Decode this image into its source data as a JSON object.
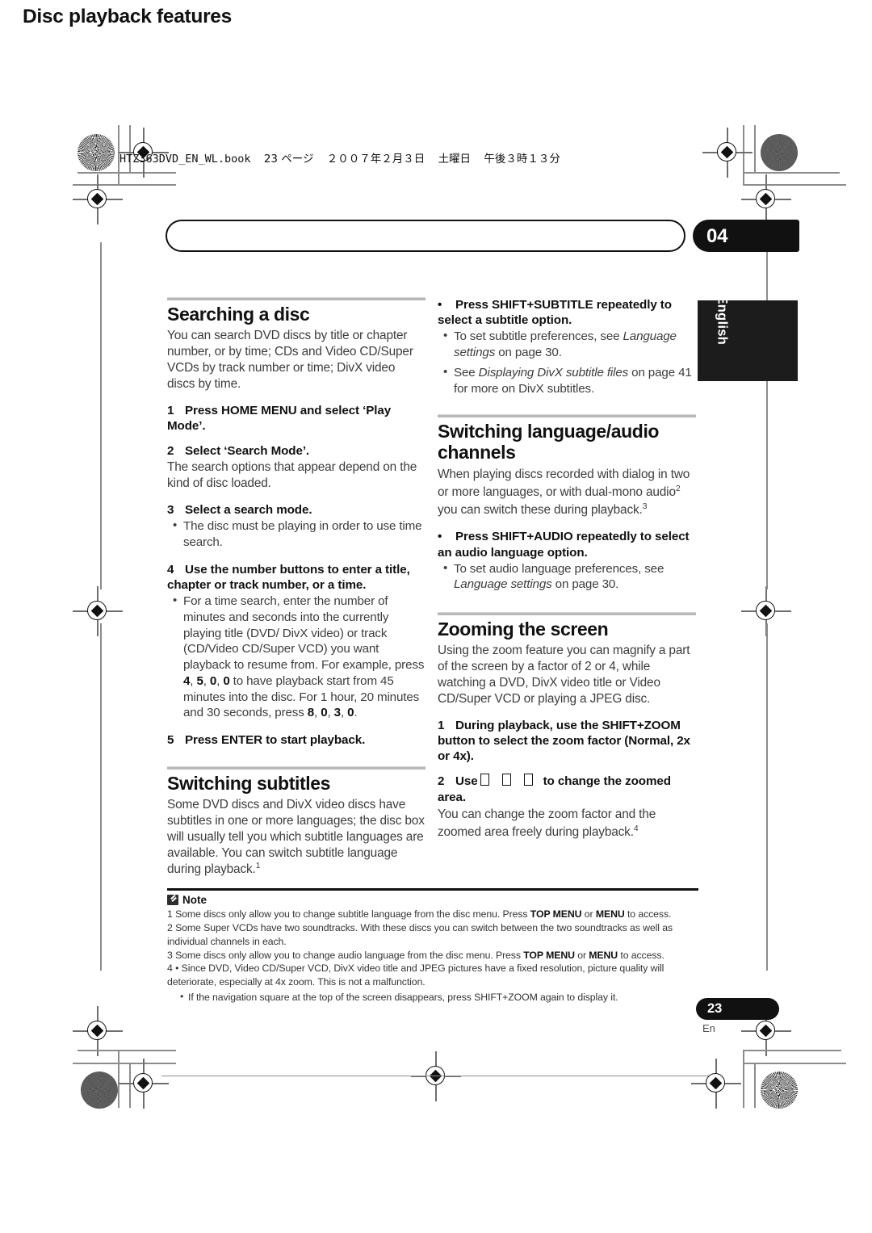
{
  "file_header": {
    "filename": "HTZ363DVD_EN_WL.book",
    "page_label": "23 ページ",
    "date": "２００７年２月３日",
    "weekday": "土曜日",
    "time": "午後３時１３分"
  },
  "running_head": {
    "title": "Disc playback features",
    "chapter": "04"
  },
  "side_tab": {
    "label": "English"
  },
  "left_column": {
    "searching": {
      "heading": "Searching a disc",
      "intro": "You can search DVD discs by title or chapter number, or by time; CDs and Video CD/Super VCDs by track number or time; DivX video discs by time.",
      "step1_num": "1",
      "step1": "Press HOME MENU and select ‘Play Mode’.",
      "step2_num": "2",
      "step2": "Select ‘Search Mode’.",
      "step2_body": "The search options that appear depend on the kind of disc loaded.",
      "step3_num": "3",
      "step3": "Select a search mode.",
      "step3_bullet": "The disc must be playing in order to use time search.",
      "step4_num": "4",
      "step4": "Use the number buttons to enter a title, chapter or track number, or a time.",
      "step4_bullet_a": "For a time search, enter the number of minutes and seconds into the currently playing title (DVD/ DivX video) or track (CD/Video CD/Super VCD) you want playback to resume from. For example, press ",
      "step4_keys_1": [
        "4",
        "5",
        "0",
        "0"
      ],
      "step4_bullet_b": " to have playback start from 45 minutes into the disc. For 1 hour, 20 minutes and 30 seconds, press ",
      "step4_keys_2": [
        "8",
        "0",
        "3",
        "0"
      ],
      "step5_num": "5",
      "step5": "Press ENTER to start playback."
    },
    "subtitles": {
      "heading": "Switching subtitles",
      "body_pre": "Some DVD discs and DivX video discs have subtitles in one or more languages; the disc box will usually tell you which subtitle languages are available. You can switch subtitle language during playback.",
      "body_sup": "1"
    }
  },
  "right_column": {
    "subtitle_action": {
      "bullet_marker": "•",
      "action": "Press SHIFT+SUBTITLE repeatedly to select a subtitle option.",
      "sub_a_pre": "To set subtitle preferences, see ",
      "sub_a_italic": "Language settings",
      "sub_a_post": " on page 30.",
      "sub_b_pre": "See ",
      "sub_b_italic": "Displaying DivX subtitle files",
      "sub_b_post": " on page 41 for more on DivX subtitles."
    },
    "language_audio": {
      "heading": "Switching language/audio channels",
      "body_a": "When playing discs recorded with dialog in two or more languages, or with dual-mono audio",
      "body_a_sup": "2",
      "body_b": " you can switch these during playback.",
      "body_b_sup": "3",
      "bullet_marker": "•",
      "action": "Press SHIFT+AUDIO repeatedly to select an audio language option.",
      "sub_pre": "To set audio language preferences, see ",
      "sub_italic": "Language settings",
      "sub_post": " on page 30."
    },
    "zooming": {
      "heading": "Zooming the screen",
      "intro": "Using the zoom feature you can magnify a part of the screen by a factor of 2 or 4, while watching a DVD, DivX video title or Video CD/Super VCD or playing a JPEG disc.",
      "step1_num": "1",
      "step1": "During playback, use the SHIFT+ZOOM button to select the zoom factor (Normal, 2x or 4x).",
      "step2_num": "2",
      "step2_pre": "Use",
      "step2_post": "to change the zoomed area.",
      "step2_body_pre": "You can change the zoom factor and the zoomed area freely during playback.",
      "step2_body_sup": "4"
    }
  },
  "notes": {
    "heading": "Note",
    "items": [
      {
        "num": "1",
        "pre": "Some discs only allow you to change subtitle language from the disc menu. Press ",
        "bold_a": "TOP MENU",
        "mid": " or ",
        "bold_b": "MENU",
        "post": " to access."
      },
      {
        "num": "2",
        "pre": "Some Super VCDs have two soundtracks. With these discs you can switch between the two soundtracks as well as individual channels in each.",
        "bold_a": "",
        "mid": "",
        "bold_b": "",
        "post": ""
      },
      {
        "num": "3",
        "pre": "Some discs only allow you to change audio language from the disc menu. Press ",
        "bold_a": "TOP MENU",
        "mid": " or ",
        "bold_b": "MENU",
        "post": " to access."
      },
      {
        "num": "4",
        "pre": "• Since DVD, Video CD/Super VCD, DivX video title and JPEG pictures have a fixed resolution, picture quality will deteriorate, especially at 4x zoom. This is not a malfunction.",
        "bold_a": "",
        "mid": "",
        "bold_b": "",
        "post": ""
      }
    ],
    "sub_note": {
      "pre": "If the navigation square at the top of the screen disappears, press ",
      "bold": "SHIFT+ZOOM",
      "post": " again to display it."
    }
  },
  "folio": {
    "page_number": "23",
    "language_code": "En"
  },
  "colors": {
    "ink": "#111111",
    "body_text": "#3d3d3d",
    "rule": "#b8b8b8",
    "mark": "#6e6e6e"
  }
}
